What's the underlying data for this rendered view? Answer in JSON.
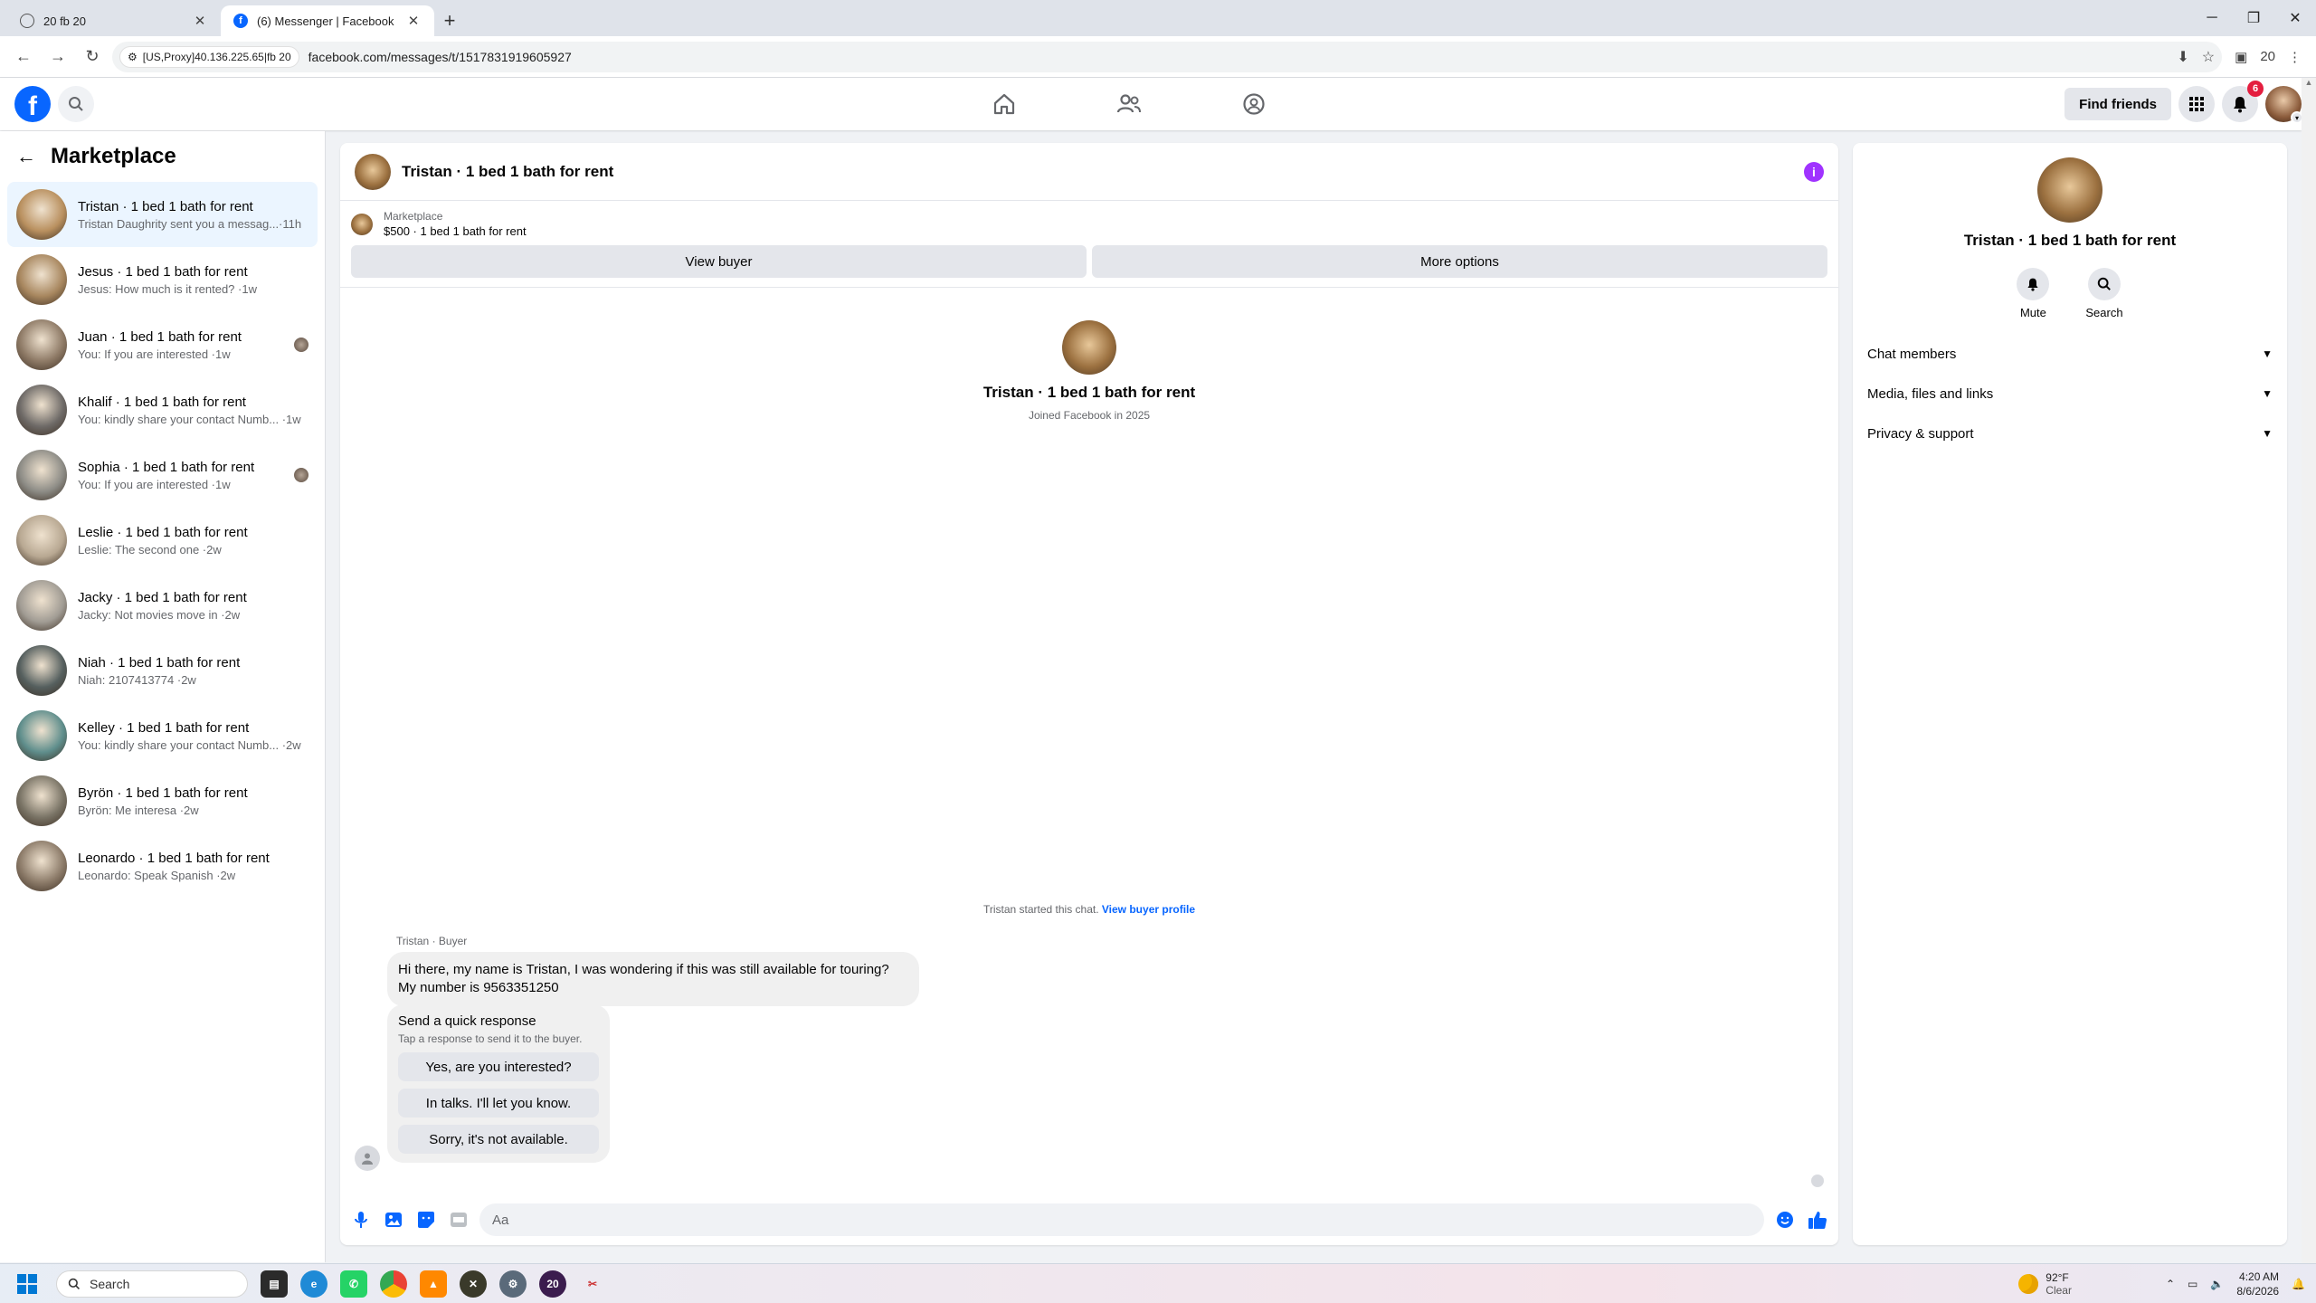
{
  "browser": {
    "tabs": [
      {
        "label": "20 fb 20",
        "active": false
      },
      {
        "label": "(6) Messenger | Facebook",
        "active": true
      }
    ],
    "proxy_chip": "[US,Proxy]40.136.225.65|fb 20",
    "url": "facebook.com/messages/t/1517831919605927",
    "profile_count": "20"
  },
  "fbnav": {
    "logo": "f",
    "find_friends": "Find friends",
    "notifications_badge": "6"
  },
  "sidebar": {
    "title": "Marketplace",
    "conversations": [
      {
        "name": "Tristan · 1 bed 1 bath for rent",
        "preview": "Tristan Daughrity sent you a messag...·11h",
        "active": true,
        "thumb": "#b9905f",
        "read_avatar": false
      },
      {
        "name": "Jesus · 1 bed 1 bath for rent",
        "preview": "Jesus: How much is it rented? ·1w",
        "active": false,
        "thumb": "#a8875f",
        "read_avatar": false
      },
      {
        "name": "Juan · 1 bed 1 bath for rent",
        "preview": "You: If you are interested ·1w",
        "active": false,
        "thumb": "#8e7a66",
        "read_avatar": true
      },
      {
        "name": "Khalif · 1 bed 1 bath for rent",
        "preview": "You: kindly share your contact Numb... ·1w",
        "active": false,
        "thumb": "#6e6a67",
        "read_avatar": false
      },
      {
        "name": "Sophia · 1 bed 1 bath for rent",
        "preview": "You: If you are interested ·1w",
        "active": false,
        "thumb": "#8d8c86",
        "read_avatar": true
      },
      {
        "name": "Leslie · 1 bed 1 bath for rent",
        "preview": "Leslie: The second one ·2w",
        "active": false,
        "thumb": "#b8a892",
        "read_avatar": false
      },
      {
        "name": "Jacky · 1 bed 1 bath for rent",
        "preview": "Jacky: Not movies move in ·2w",
        "active": false,
        "thumb": "#a19c94",
        "read_avatar": false
      },
      {
        "name": "Niah · 1 bed 1 bath for rent",
        "preview": "Niah: 2107413774 ·2w",
        "active": false,
        "thumb": "#56605f",
        "read_avatar": false
      },
      {
        "name": "Kelley · 1 bed 1 bath for rent",
        "preview": "You: kindly share your contact Numb... ·2w",
        "active": false,
        "thumb": "#5f8e8c",
        "read_avatar": false
      },
      {
        "name": "Byrön · 1 bed 1 bath for rent",
        "preview": "Byrön: Me interesa ·2w",
        "active": false,
        "thumb": "#7a7466",
        "read_avatar": false
      },
      {
        "name": "Leonardo · 1 bed 1 bath for rent",
        "preview": "Leonardo: Speak Spanish ·2w",
        "active": false,
        "thumb": "#8c7b69",
        "read_avatar": false
      }
    ]
  },
  "chat": {
    "title": "Tristan · 1 bed 1 bath for rent",
    "listing_source": "Marketplace",
    "listing_info": "$500 · 1 bed 1 bath for rent",
    "view_buyer": "View buyer",
    "more_options": "More options",
    "intro_name": "Tristan · 1 bed 1 bath for rent",
    "intro_joined": "Joined Facebook in 2025",
    "started_text": "Tristan started this chat.",
    "view_buyer_profile": "View buyer profile",
    "sender_label": "Tristan · Buyer",
    "message": "Hi there, my name is Tristan, I was wondering if this was still available for touring? My number is 9563351250",
    "quick_title": "Send a quick response",
    "quick_sub": "Tap a response to send it to the buyer.",
    "quick_replies": [
      "Yes, are you interested?",
      "In talks. I'll let you know.",
      "Sorry, it's not available."
    ],
    "input_placeholder": "Aa"
  },
  "right_panel": {
    "name": "Tristan · 1 bed 1 bath for rent",
    "mute": "Mute",
    "search": "Search",
    "sections": [
      "Chat members",
      "Media, files and links",
      "Privacy & support"
    ]
  },
  "taskbar": {
    "search_placeholder": "Search",
    "weather_temp": "92°F",
    "weather_desc": "Clear",
    "time": "4:20 AM",
    "date": "8/6/2026",
    "app_badge": "20"
  },
  "colors": {
    "fb_blue": "#0866ff",
    "active_conv_bg": "#ebf5ff",
    "badge_red": "#e41e3f",
    "info_purple": "#a033ff"
  }
}
